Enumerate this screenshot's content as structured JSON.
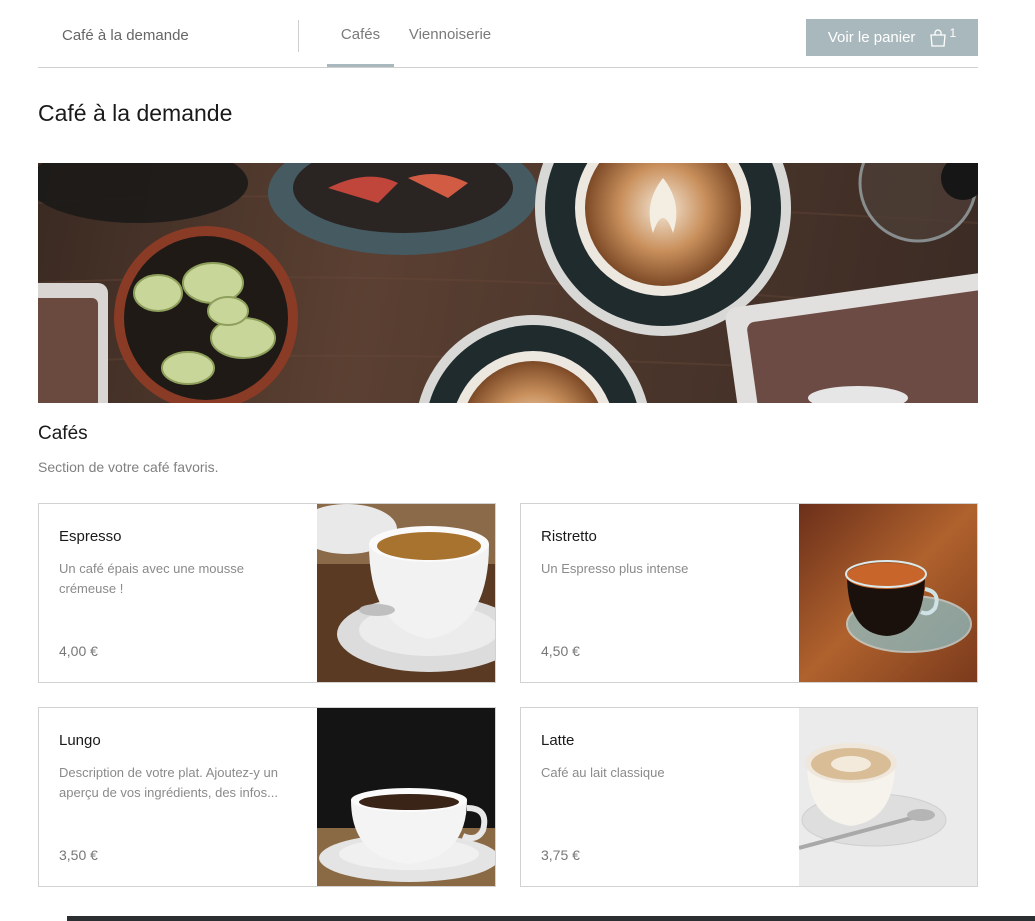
{
  "header": {
    "menu_name": "Café à la demande",
    "tabs": [
      {
        "label": "Cafés",
        "active": true
      },
      {
        "label": "Viennoiserie",
        "active": false
      }
    ],
    "cart": {
      "label": "Voir le panier",
      "count": "1",
      "icon": "shopping-bag-icon"
    }
  },
  "page_title": "Café à la demande",
  "section": {
    "title": "Cafés",
    "description": "Section de votre café favoris."
  },
  "items": [
    {
      "name": "Espresso",
      "description": "Un café épais avec une mousse crémeuse !",
      "price": "4,00 €"
    },
    {
      "name": "Ristretto",
      "description": "Un Espresso plus intense",
      "price": "4,50 €"
    },
    {
      "name": "Lungo",
      "description": "Description de votre plat. Ajoutez-y un aperçu de vos ingrédients, des infos...",
      "price": "3,50 €"
    },
    {
      "name": "Latte",
      "description": "Café au lait classique",
      "price": "3,75 €"
    }
  ],
  "colors": {
    "accent": "#a9b8bc",
    "border": "#d2d2d2",
    "muted_text": "#808080"
  }
}
